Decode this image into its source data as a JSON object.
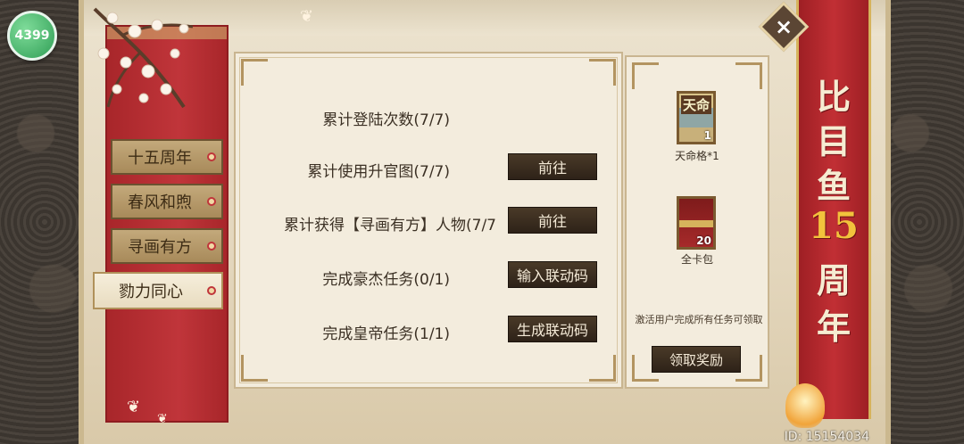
{
  "logo": {
    "text": "4399"
  },
  "tabs": [
    {
      "label": "十五周年",
      "active": false
    },
    {
      "label": "春风和煦",
      "active": false
    },
    {
      "label": "寻画有方",
      "active": false
    },
    {
      "label": "勠力同心",
      "active": true
    }
  ],
  "tasks": [
    {
      "label": "累计登陆次数(7/7)",
      "button": null
    },
    {
      "label": "累计使用升官图(7/7)",
      "button": "前往"
    },
    {
      "label": "累计获得【寻画有方】人物(7/7",
      "button": "前往"
    },
    {
      "label": "完成豪杰任务(0/1)",
      "button": "输入联动码"
    },
    {
      "label": "完成皇帝任务(1/1)",
      "button": "生成联动码"
    }
  ],
  "rewards": {
    "items": [
      {
        "card_text": "天命",
        "count": "1",
        "name": "天命格*1",
        "icon": "tianming-card-icon"
      },
      {
        "card_text": "",
        "count": "20",
        "name": "全卡包",
        "icon": "card-pack-icon"
      }
    ],
    "hint": "激活用户完成所有任务可领取",
    "claim_label": "领取奖励"
  },
  "banner": {
    "chars": [
      "比",
      "目",
      "鱼",
      "15",
      "周",
      "年"
    ]
  },
  "close_icon": "×",
  "uid": "ID: 15154034",
  "colors": {
    "banner_red": "#c12f34",
    "button_dark": "#2e2218",
    "gold": "#f2c23c"
  }
}
